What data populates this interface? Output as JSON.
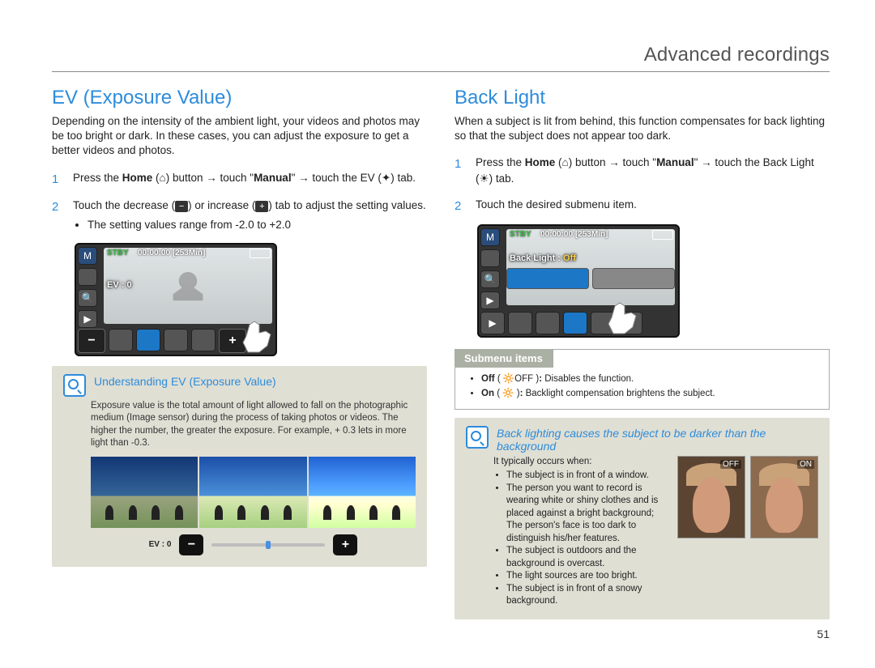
{
  "header": {
    "title": "Advanced recordings"
  },
  "page_number": "51",
  "left": {
    "heading": "EV (Exposure Value)",
    "intro": "Depending on the intensity of the ambient light, your videos and photos may be too bright or dark. In these cases, you can adjust the exposure to get a better videos and photos.",
    "step1_num": "1",
    "step1_a": "Press the ",
    "step1_home": "Home",
    "step1_b": " (",
    "step1_c": ") button → touch \"",
    "step1_manual": "Manual",
    "step1_d": "\" → touch the EV (",
    "step1_e": ") tab.",
    "step2_num": "2",
    "step2_a": "Touch the decrease (",
    "step2_b": ") or increase (",
    "step2_c": ") tab to adjust the setting values.",
    "step2_bullet": "The setting values range from -2.0 to +2.0",
    "cam": {
      "stby": "STBY",
      "time": "00:00:00",
      "rem": "[253Min]",
      "ev_label": "EV :",
      "ev_value": "0"
    },
    "callout": {
      "title": "Understanding EV (Exposure Value)",
      "body": "Exposure value is the total amount of light allowed to fall on the photographic medium (Image sensor) during the process of taking photos or videos. The higher the number, the greater the exposure. For example, + 0.3 lets in more light than -0.3.",
      "strip_label": "EV :",
      "strip_value": "0",
      "minus": "−",
      "plus": "+"
    }
  },
  "right": {
    "heading": "Back Light",
    "intro": "When a subject is lit from behind, this function compensates for back lighting so that the subject does not appear too dark.",
    "step1_num": "1",
    "step1_a": "Press the ",
    "step1_home": "Home",
    "step1_b": " (",
    "step1_c": ") button → touch \"",
    "step1_manual": "Manual",
    "step1_d": "\" → touch the Back Light (",
    "step1_e": ") tab.",
    "step2_num": "2",
    "step2_text": "Touch the desired submenu item.",
    "cam": {
      "stby": "STBY",
      "time": "00:00:00",
      "rem": "[253Min]",
      "label": "Back Light :",
      "value": "Off"
    },
    "submenu": {
      "heading": "Submenu items",
      "off_label": "Off",
      "off_icon": "( 🔆OFF )",
      "off_text": "Disables the function.",
      "on_label": "On",
      "on_icon": "( 🔆 )",
      "on_text": "Backlight compensation brightens the subject."
    },
    "callout": {
      "title": "Back lighting causes the subject to be darker than the background",
      "lead": "It typically occurs when:",
      "b1": "The subject is in front of a window.",
      "b2": "The person you want to record is wearing white or shiny clothes and is placed against a bright background; The person's face is too dark to distinguish his/her features.",
      "b3": "The subject is outdoors and the background is overcast.",
      "b4": "The light sources are too bright.",
      "b5": "The subject is in front of a snowy background.",
      "img_off": "OFF",
      "img_on": "ON"
    }
  },
  "icons": {
    "home": "⌂",
    "ev": "✦",
    "minus": "−",
    "plus": "+",
    "backlight": "☀"
  }
}
